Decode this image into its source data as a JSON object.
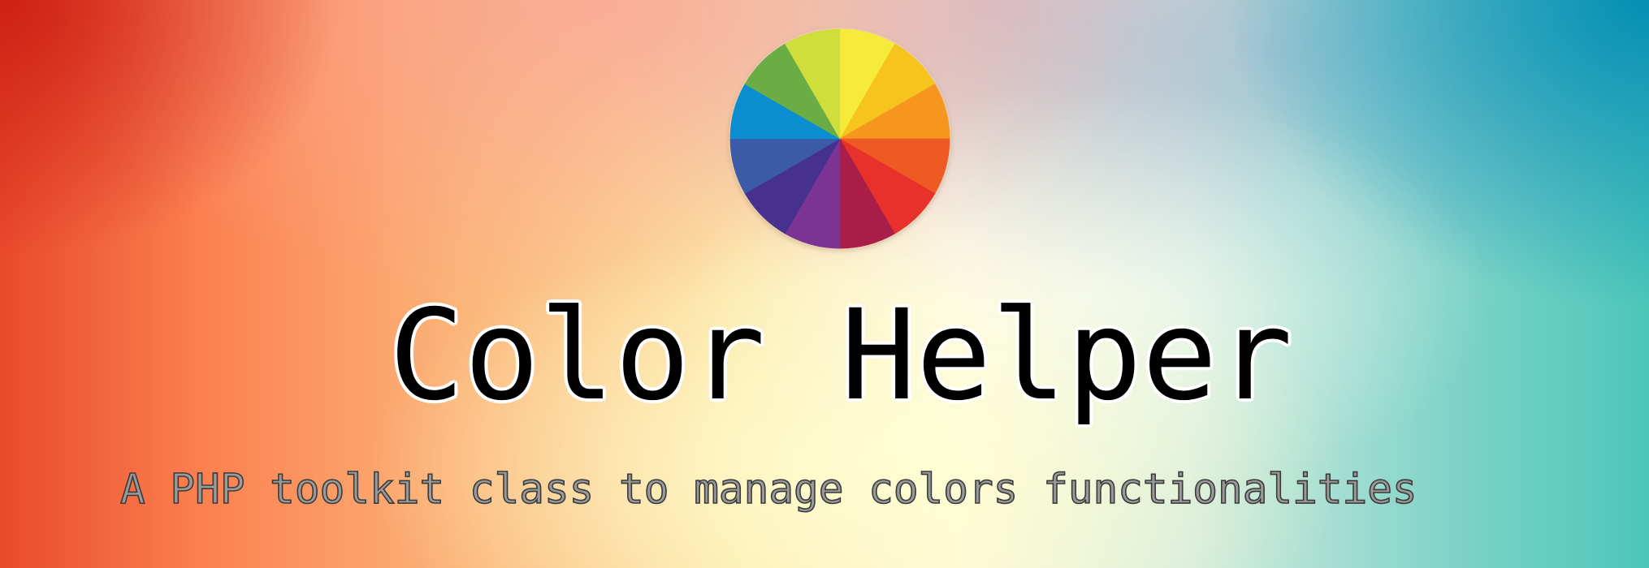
{
  "banner": {
    "title": "Color Helper",
    "subtitle": "A PHP toolkit class to manage colors functionalities"
  },
  "logo": {
    "icon": "color-wheel-icon",
    "segment_colors": [
      "#f6ea3b",
      "#f7c31d",
      "#f7961f",
      "#ef5a24",
      "#e8312a",
      "#a91e48",
      "#7b3494",
      "#46318f",
      "#3b5ba8",
      "#0b8ecf",
      "#6aad45",
      "#cfde3b"
    ]
  }
}
